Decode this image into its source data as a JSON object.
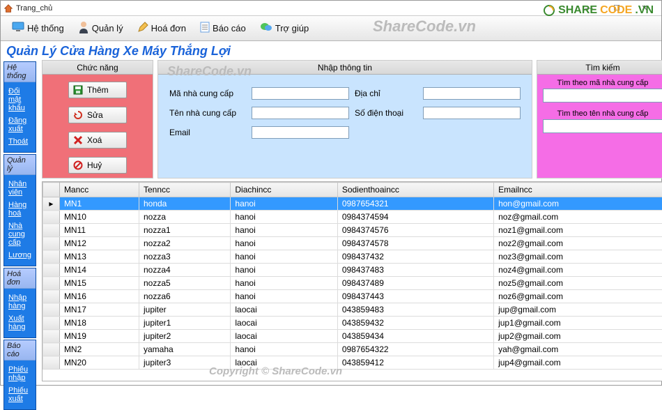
{
  "window": {
    "title": "Trang_chủ"
  },
  "menubar": {
    "items": [
      {
        "label": "Hệ thống",
        "icon": "monitor-icon"
      },
      {
        "label": "Quản lý",
        "icon": "user-icon"
      },
      {
        "label": "Hoá đơn",
        "icon": "pencil-icon"
      },
      {
        "label": "Báo cáo",
        "icon": "document-icon"
      },
      {
        "label": "Trợ giúp",
        "icon": "chat-icon"
      }
    ]
  },
  "page": {
    "title": "Quản Lý Cửa Hàng Xe Máy Thắng Lợi"
  },
  "sidebar": {
    "groups": [
      {
        "header": "Hệ thống",
        "links": [
          "Đổi mật khẩu",
          "Đăng xuất",
          "Thoát"
        ]
      },
      {
        "header": "Quản lý",
        "links": [
          "Nhân viên",
          "Hàng hoá",
          "Nhà cung cấp",
          "Lương"
        ]
      },
      {
        "header": "Hoá đơn",
        "links": [
          "Nhập hàng",
          "Xuất hàng"
        ]
      },
      {
        "header": "Báo cáo",
        "links": [
          "Phiếu nhập",
          "Phiếu xuất"
        ]
      }
    ]
  },
  "panel_func": {
    "header": "Chức năng",
    "buttons": [
      {
        "label": "Thêm",
        "icon": "floppy-icon"
      },
      {
        "label": "Sửa",
        "icon": "refresh-icon"
      },
      {
        "label": "Xoá",
        "icon": "x-icon"
      },
      {
        "label": "Huỷ",
        "icon": "cancel-icon"
      }
    ]
  },
  "panel_info": {
    "header": "Nhập thông tin",
    "fields": {
      "mancc": "Mã nhà cung cấp",
      "tenncc": "Tên nhà cung cấp",
      "email": "Email",
      "diachi": "Địa chỉ",
      "sdt": "Số điện thoại"
    },
    "values": {
      "mancc": "",
      "tenncc": "",
      "email": "",
      "diachi": "",
      "sdt": ""
    }
  },
  "panel_search": {
    "header": "Tìm kiếm",
    "label1": "Tìm theo mã nhà cung cấp",
    "label2": "Tìm theo tên nhà cung cấp",
    "value1": "",
    "value2": ""
  },
  "grid": {
    "columns": [
      "Mancc",
      "Tenncc",
      "Diachincc",
      "Sodienthoaincc",
      "Emailncc"
    ],
    "rows": [
      [
        "MN1",
        "honda",
        "hanoi",
        "0987654321",
        "hon@gmail.com"
      ],
      [
        "MN10",
        "nozza",
        "hanoi",
        "0984374594",
        "noz@gmail.com"
      ],
      [
        "MN11",
        "nozza1",
        "hanoi",
        "0984374576",
        "noz1@gmail.com"
      ],
      [
        "MN12",
        "nozza2",
        "hanoi",
        "0984374578",
        "noz2@gmail.com"
      ],
      [
        "MN13",
        "nozza3",
        "hanoi",
        "098437432",
        "noz3@gmail.com"
      ],
      [
        "MN14",
        "nozza4",
        "hanoi",
        "098437483",
        "noz4@gmail.com"
      ],
      [
        "MN15",
        "nozza5",
        "hanoi",
        "098437489",
        "noz5@gmail.com"
      ],
      [
        "MN16",
        "nozza6",
        "hanoi",
        "098437443",
        "noz6@gmail.com"
      ],
      [
        "MN17",
        "jupiter",
        "laocai",
        "043859483",
        "jup@gmail.com"
      ],
      [
        "MN18",
        "jupiter1",
        "laocai",
        "043859432",
        "jup1@gmail.com"
      ],
      [
        "MN19",
        "jupiter2",
        "laocai",
        "043859434",
        "jup2@gmail.com"
      ],
      [
        "MN2",
        "yamaha",
        "hanoi",
        "0987654322",
        "yah@gmail.com"
      ],
      [
        "MN20",
        "jupiter3",
        "laocai",
        "043859412",
        "jup4@gmail.com"
      ]
    ],
    "selected_row": 0
  },
  "watermarks": {
    "brand": "ShareCode.vn",
    "logo_green": "SHARE",
    "logo_orange": "CODE",
    "copyright": "Copyright © ShareCode.vn"
  }
}
